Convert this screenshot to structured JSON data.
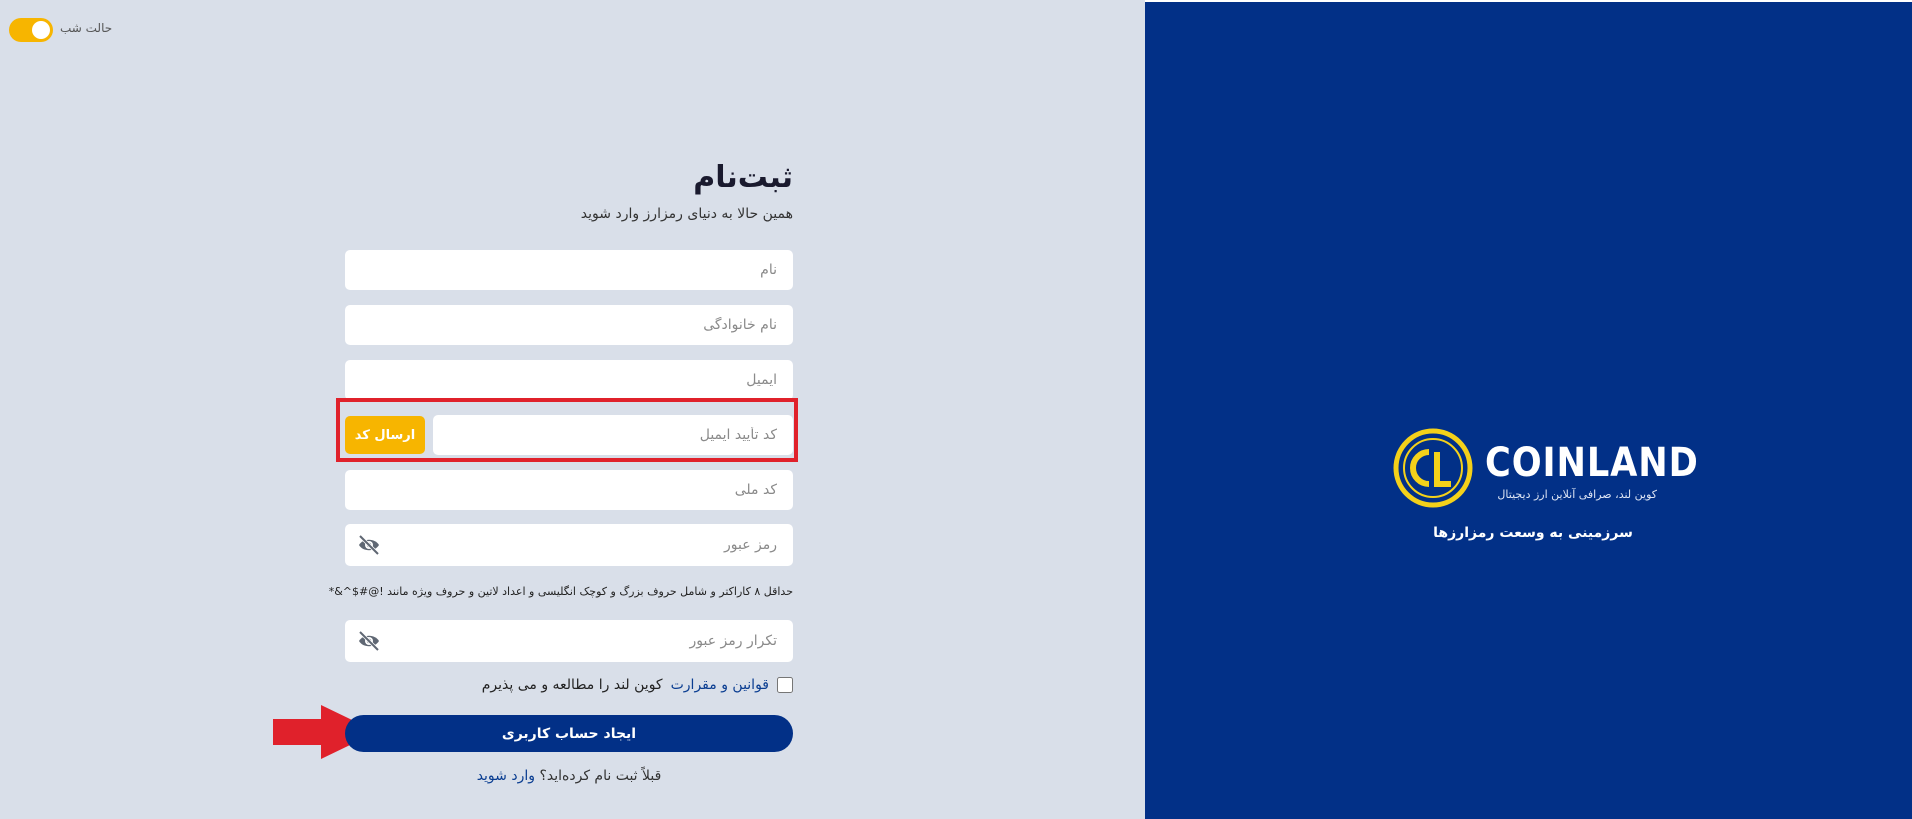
{
  "night_mode": {
    "label": "حالت شب",
    "enabled": true
  },
  "form": {
    "title": "ثبت‌نام",
    "subtitle": "همین حالا به دنیای رمزارز وارد شوید",
    "first_name_placeholder": "نام",
    "last_name_placeholder": "نام خانوادگی",
    "email_placeholder": "ایمیل",
    "email_code_placeholder": "کد تأیید ایمیل",
    "send_code_label": "ارسال کد",
    "national_id_placeholder": "کد ملی",
    "password_placeholder": "رمز عبور",
    "password_hint": "حداقل ۸ کاراکتر و شامل حروف بزرگ و کوچک انگلیسی و اعداد لاتین و حروف ویژه مانند !@#$^&*",
    "confirm_password_placeholder": "تکرار رمز عبور",
    "terms_link": "قوانین و مقرارت",
    "terms_text": "کوین لند را مطالعه و می پذیرم",
    "submit_label": "ایجاد حساب کاربری",
    "login_prompt": "قبلاً ثبت نام کرده‌اید؟",
    "login_link": "وارد شوید"
  },
  "brand": {
    "name": "COINLAND",
    "tagline": "کوین لند، صرافی آنلاین ارز دیجیتال",
    "slogan": "سرزمینی به وسعت رمزارزها"
  },
  "icons": {
    "password_toggle": "eye-slash-icon",
    "logo": "cl-coin-logo"
  },
  "colors": {
    "primary": "#023087",
    "accent": "#f7b500",
    "highlight": "#e0212b"
  }
}
